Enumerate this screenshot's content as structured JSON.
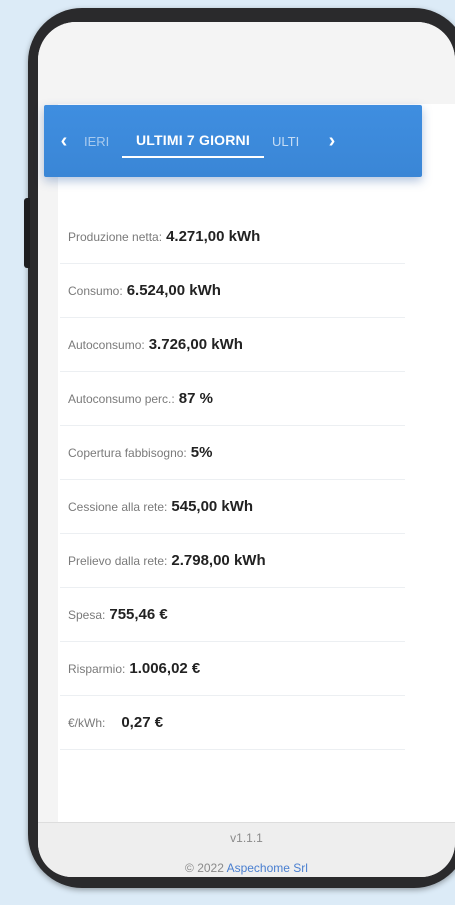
{
  "tabs": {
    "prev_label": "IERI",
    "current_label": "ULTIMI 7 GIORNI",
    "next_label": "ULTI",
    "prev_icon": "chevron-left-icon",
    "next_icon": "chevron-right-icon"
  },
  "stats": [
    {
      "label": "Produzione netta:",
      "value": "4.271,00 kWh"
    },
    {
      "label": "Consumo:",
      "value": "6.524,00 kWh"
    },
    {
      "label": "Autoconsumo:",
      "value": "3.726,00 kWh"
    },
    {
      "label": "Autoconsumo perc.:",
      "value": "87 %"
    },
    {
      "label": "Copertura fabbisogno:",
      "value": "5%"
    },
    {
      "label": "Cessione alla rete:",
      "value": "545,00 kWh"
    },
    {
      "label": "Prelievo dalla rete:",
      "value": "2.798,00 kWh"
    },
    {
      "label": "Spesa:",
      "value": "755,46 €"
    },
    {
      "label": "Risparmio:",
      "value": "1.006,02 €"
    },
    {
      "label": "€/kWh:",
      "value": "0,27 €"
    }
  ],
  "footer": {
    "version": "v1.1.1",
    "copyright_prefix": "© 2022",
    "brand": "Aspechome Srl"
  },
  "colors": {
    "accent": "#3a86d6",
    "background": "#dcebf7"
  }
}
